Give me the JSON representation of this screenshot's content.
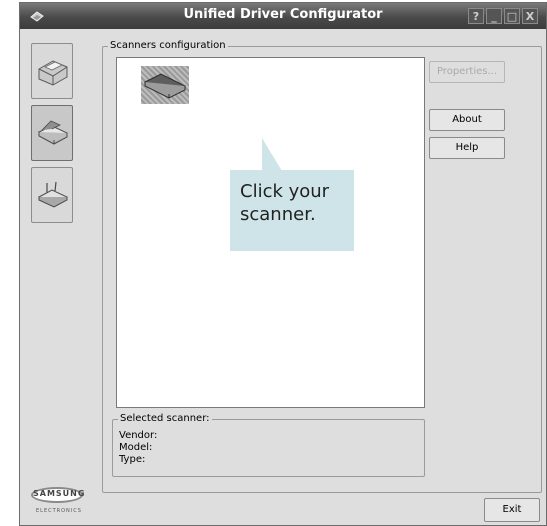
{
  "window": {
    "title": "Unified Driver Configurator"
  },
  "titlebar_buttons": {
    "help": "?",
    "minimize": "_",
    "maximize": "□",
    "close": "X"
  },
  "nav": [
    "printer-configuration",
    "scanner-configuration",
    "ports-configuration"
  ],
  "scanners_group": {
    "label": "Scanners configuration"
  },
  "callout": {
    "text": "Click your scanner."
  },
  "buttons": {
    "properties": "Properties...",
    "about": "About",
    "help": "Help",
    "exit": "Exit"
  },
  "selected_scanner": {
    "label": "Selected scanner:",
    "vendor_label": "Vendor:",
    "model_label": "Model:",
    "type_label": "Type:"
  },
  "logo": {
    "brand": "SAMSUNG",
    "sub": "ELECTRONICS"
  }
}
